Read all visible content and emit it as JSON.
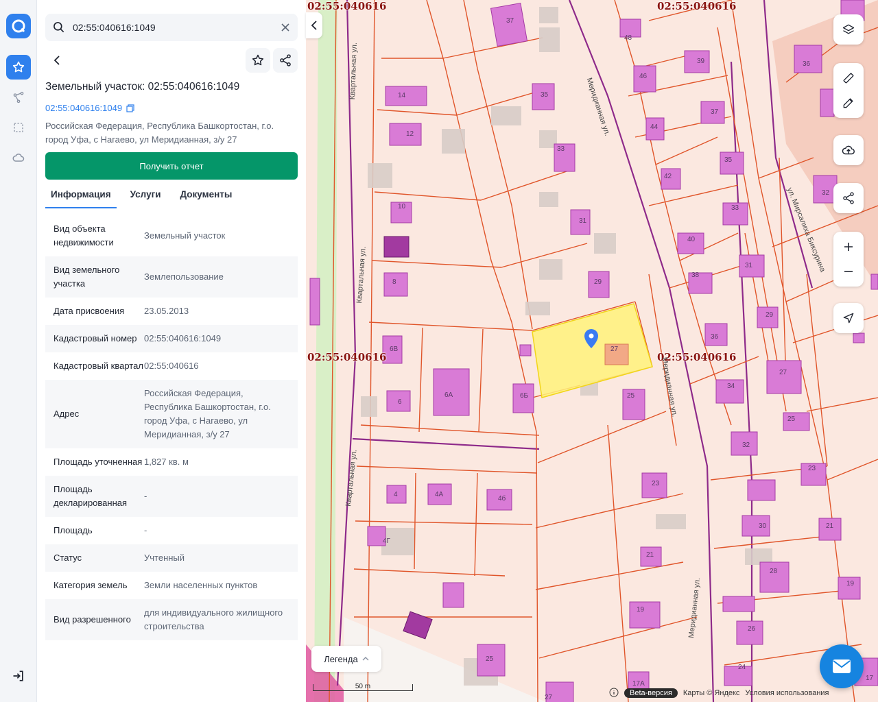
{
  "search": {
    "value": "02:55:040616:1049"
  },
  "panel": {
    "title": "Земельный участок: 02:55:040616:1049",
    "cad_link": "02:55:040616:1049",
    "address": "Российская Федерация, Республика Башкортостан, г.о. город Уфа, с Нагаево, ул Меридианная, з/у 27",
    "report_button": "Получить отчет",
    "tabs": [
      {
        "label": "Информация",
        "active": true
      },
      {
        "label": "Услуги",
        "active": false
      },
      {
        "label": "Документы",
        "active": false
      }
    ],
    "info": [
      {
        "k": "Вид объекта недвижимости",
        "v": "Земельный участок"
      },
      {
        "k": "Вид земельного участка",
        "v": "Землепользование"
      },
      {
        "k": "Дата присвоения",
        "v": "23.05.2013"
      },
      {
        "k": "Кадастровый номер",
        "v": "02:55:040616:1049"
      },
      {
        "k": "Кадастровый квартал",
        "v": "02:55:040616"
      },
      {
        "k": "Адрес",
        "v": "Российская Федерация, Республика Башкортостан, г.о. город Уфа, с Нагаево, ул Меридианная, з/у 27"
      },
      {
        "k": "Площадь уточненная",
        "v": "1,827 кв. м"
      },
      {
        "k": "Площадь декларированная",
        "v": "-"
      },
      {
        "k": "Площадь",
        "v": "-"
      },
      {
        "k": "Статус",
        "v": "Учтенный"
      },
      {
        "k": "Категория земель",
        "v": "Земли населенных пунктов"
      },
      {
        "k": "Вид разрешенного",
        "v": "для индивидуального жилищного строительства"
      }
    ]
  },
  "map": {
    "quarter_label": "02:55:040616",
    "streets": {
      "kvartalnaya": "Квартальная ул.",
      "meridiannaya": "Меридианная ул.",
      "miraslikha": "ул. Мирсалиха Биксурина"
    },
    "house_numbers": [
      "37",
      "14",
      "35",
      "12",
      "33",
      "10",
      "31",
      "8",
      "29",
      "6В",
      "27",
      "6",
      "6А",
      "6Б",
      "25",
      "4",
      "4А",
      "4б",
      "23",
      "4Г",
      "21",
      "19",
      "25",
      "17А",
      "27",
      "48",
      "39",
      "46",
      "37",
      "44",
      "35",
      "42",
      "33",
      "40",
      "31",
      "38",
      "29",
      "36",
      "27",
      "34",
      "25",
      "32",
      "23",
      "30",
      "21",
      "28",
      "19",
      "26",
      "24",
      "17",
      "36",
      "32"
    ],
    "legend_label": "Легенда",
    "scale_label": "50 m",
    "footer": {
      "beta": "Beta-версия",
      "maps": "Карты © Яндекс",
      "terms": "Условия использования"
    }
  }
}
